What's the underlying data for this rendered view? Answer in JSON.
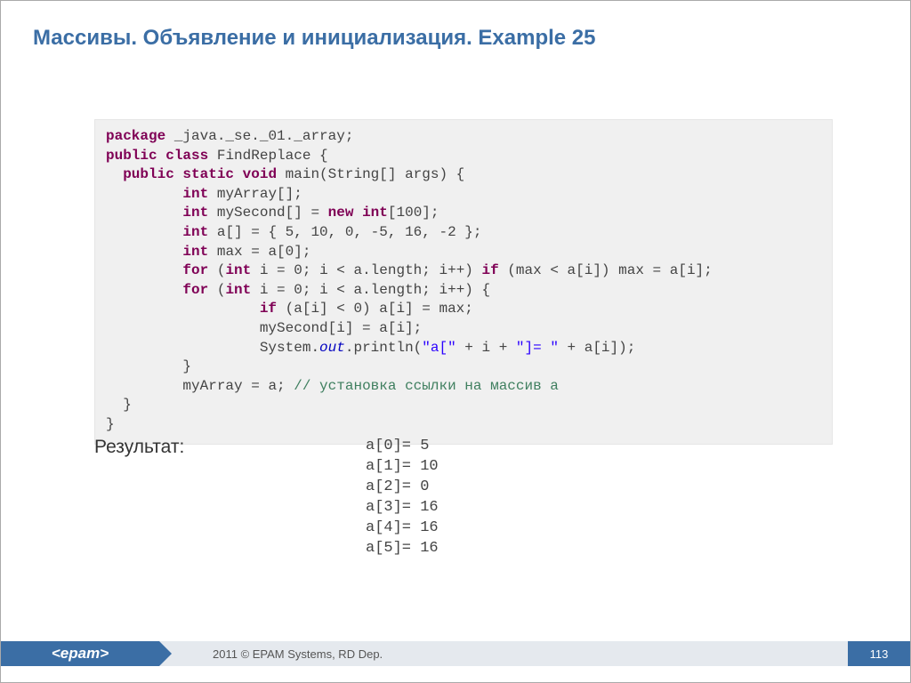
{
  "title": "Массивы. Объявление и инициализация. Example 25",
  "result_label": "Результат:",
  "code": {
    "l1_kw": "package",
    "l1_rest": " _java._se._01._array;",
    "l2_kw1": "public",
    "l2_kw2": "class",
    "l2_rest": " FindReplace {",
    "l3_kw1": "public",
    "l3_kw2": "static",
    "l3_kw3": "void",
    "l3_rest": " main(String[] args) {",
    "l4_kw": "int",
    "l4_rest": " myArray[];",
    "l5_kw1": "int",
    "l5_mid": " mySecond[] = ",
    "l5_kw2": "new",
    "l5_kw3": "int",
    "l5_rest": "[100];",
    "l6_kw": "int",
    "l6_rest": " a[] = { 5, 10, 0, -5, 16, -2 };",
    "l7_kw": "int",
    "l7_rest": " max = a[0];",
    "l8_kw1": "for",
    "l8_a": " (",
    "l8_kw2": "int",
    "l8_b": " i = 0; i < a.length; i++) ",
    "l8_kw3": "if",
    "l8_c": " (max < a[i]) max = a[i];",
    "l9_kw1": "for",
    "l9_a": " (",
    "l9_kw2": "int",
    "l9_b": " i = 0; i < a.length; i++) {",
    "l10_kw": "if",
    "l10_rest": " (a[i] < 0) a[i] = max;",
    "l11": "mySecond[i] = a[i];",
    "l12_a": "System.",
    "l12_fld": "out",
    "l12_b": ".println(",
    "l12_s1": "\"a[\"",
    "l12_c": " + i + ",
    "l12_s2": "\"]= \"",
    "l12_d": " + a[i]);",
    "l13": "}",
    "l14_a": "myArray = a; ",
    "l14_cmt": "// установка ссылки на массив a",
    "l15": "}",
    "l16": "}"
  },
  "output": "a[0]= 5\na[1]= 10\na[2]= 0\na[3]= 16\na[4]= 16\na[5]= 16",
  "footer": {
    "logo": "<epam>",
    "copyright": "2011 © EPAM Systems, RD Dep.",
    "page": "113"
  }
}
